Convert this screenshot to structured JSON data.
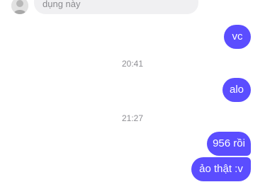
{
  "incoming": {
    "text": "dụng này"
  },
  "messages": {
    "vc": "vc",
    "alo": "alo",
    "m956": "956 rồi",
    "ao": "ảo thật :v"
  },
  "timestamps": {
    "t1": "20:41",
    "t2": "21:27"
  },
  "colors": {
    "outgoing_bubble": "#5b4dff",
    "incoming_bubble": "#f0f0f2",
    "timestamp_text": "#8e8e93"
  },
  "icons": {
    "avatar": "avatar-icon"
  }
}
